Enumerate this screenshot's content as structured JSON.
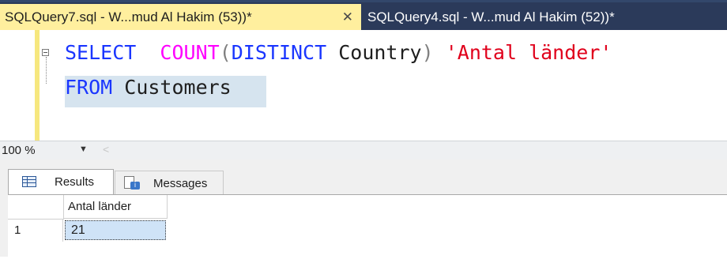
{
  "tabs": [
    {
      "label": "SQLQuery7.sql - W...mud Al Hakim (53))*",
      "close": "✕"
    },
    {
      "label": "SQLQuery4.sql - W...mud Al Hakim (52))*"
    }
  ],
  "editor": {
    "line1": {
      "select": "SELECT",
      "count": "COUNT",
      "open_paren": "(",
      "distinct": "DISTINCT",
      "country": " Country",
      "close_paren": ")",
      "alias": "'Antal länder'"
    },
    "line2": {
      "from": "FROM",
      "table": " Customers"
    }
  },
  "statusbar": {
    "zoom": "100 %",
    "dropdown_arrow": "▼",
    "scroll_left": "<"
  },
  "results_tabs": {
    "results": "Results",
    "messages": "Messages"
  },
  "grid": {
    "columns": [
      "Antal länder"
    ],
    "rows": [
      {
        "num": "1",
        "values": [
          "21"
        ]
      }
    ]
  },
  "colors": {
    "tabstrip_bg": "#2b3a5a",
    "active_tab_bg": "#ffef9e",
    "keyword": "#1a36ff",
    "function": "#ff00ff",
    "string": "#e0001b",
    "selection": "#cfe3f7"
  }
}
